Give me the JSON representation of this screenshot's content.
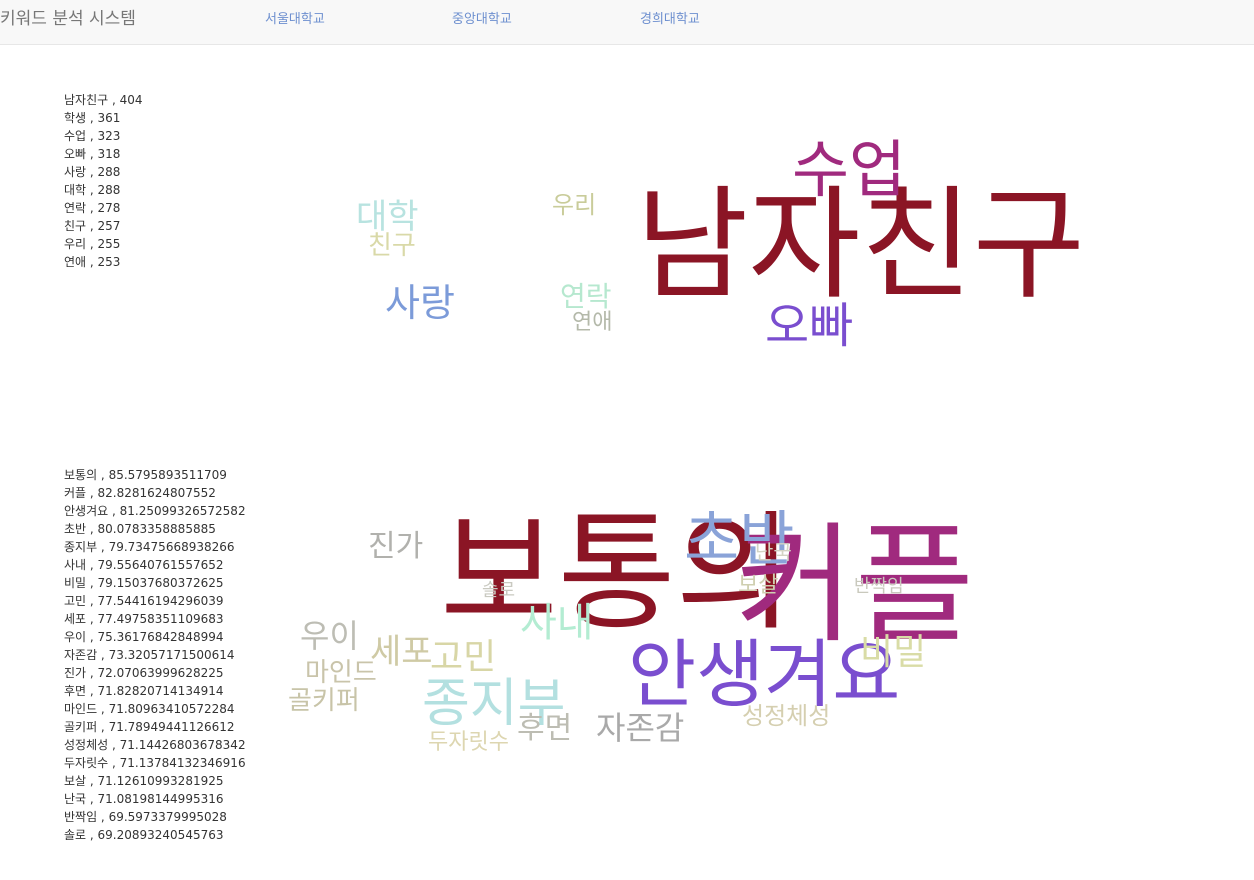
{
  "nav": {
    "brand": "키워드 분석 시스템",
    "links": [
      "서울대학교",
      "중앙대학교",
      "경희대학교"
    ]
  },
  "section1": {
    "list": [
      "남자친구 , 404",
      "학생 , 361",
      "수업 , 323",
      "오빠 , 318",
      "사랑 , 288",
      "대학 , 288",
      "연락 , 278",
      "친구 , 257",
      "우리 , 255",
      "연애 , 253"
    ],
    "cloud": [
      {
        "text": "남자친구",
        "color": "#8b1525"
      },
      {
        "text": "수업",
        "color": "#a02a7e"
      },
      {
        "text": "오빠",
        "color": "#7a4ecf"
      },
      {
        "text": "사랑",
        "color": "#7c9bd9"
      },
      {
        "text": "대학",
        "color": "#b8e3e0"
      },
      {
        "text": "친구",
        "color": "#d9d9a8"
      },
      {
        "text": "우리",
        "color": "#c9cc9a"
      },
      {
        "text": "연락",
        "color": "#b6e8cf"
      },
      {
        "text": "연애",
        "color": "#b4b9aa"
      }
    ]
  },
  "section2": {
    "list": [
      "보통의 , 85.5795893511709",
      "커플 , 82.8281624807552",
      "안생겨요 , 81.25099326572582",
      "초반 , 80.0783358885885",
      "종지부 , 79.73475668938266",
      "사내 , 79.55640761557652",
      "비밀 , 79.15037680372625",
      "고민 , 77.54416194296039",
      "세포 , 77.49758351109683",
      "우이 , 75.36176842848994",
      "자존감 , 73.32057171500614",
      "진가 , 72.07063999628225",
      "후면 , 71.82820714134914",
      "마인드 , 71.80963410572284",
      "골키퍼 , 71.78949441126612",
      "성정체성 , 71.14426803678342",
      "두자릿수 , 71.13784132346916",
      "보살 , 71.12610993281925",
      "난국 , 71.08198144995316",
      "반짝임 , 69.5973379995028",
      "솔로 , 69.20893240545763"
    ],
    "cloud": [
      {
        "text": "보통의",
        "color": "#8b1525"
      },
      {
        "text": "커플",
        "color": "#a02a7e"
      },
      {
        "text": "안생겨요",
        "color": "#7a4ecf"
      },
      {
        "text": "초반",
        "color": "#8aa3d8"
      },
      {
        "text": "종지부",
        "color": "#b3e0e0"
      },
      {
        "text": "사내",
        "color": "#b3ecd2"
      },
      {
        "text": "비밀",
        "color": "#d9dca6"
      },
      {
        "text": "고민",
        "color": "#d8d6a6"
      },
      {
        "text": "세포",
        "color": "#cfcaa5"
      },
      {
        "text": "우이",
        "color": "#bdbdb4"
      },
      {
        "text": "자존감",
        "color": "#a9a9a9"
      },
      {
        "text": "진가",
        "color": "#b1b1ad"
      },
      {
        "text": "후면",
        "color": "#bdbdb3"
      },
      {
        "text": "마인드",
        "color": "#c9c4aa"
      },
      {
        "text": "골키퍼",
        "color": "#c8c4a8"
      },
      {
        "text": "성정체성",
        "color": "#d5cfb0"
      },
      {
        "text": "두자릿수",
        "color": "#ddd6b0"
      },
      {
        "text": "보살",
        "color": "#cfcfb0"
      },
      {
        "text": "난국",
        "color": "#d3d3c3"
      },
      {
        "text": "반짝임",
        "color": "#c9c9bd"
      },
      {
        "text": "솔로",
        "color": "#c9c9c0"
      }
    ]
  }
}
